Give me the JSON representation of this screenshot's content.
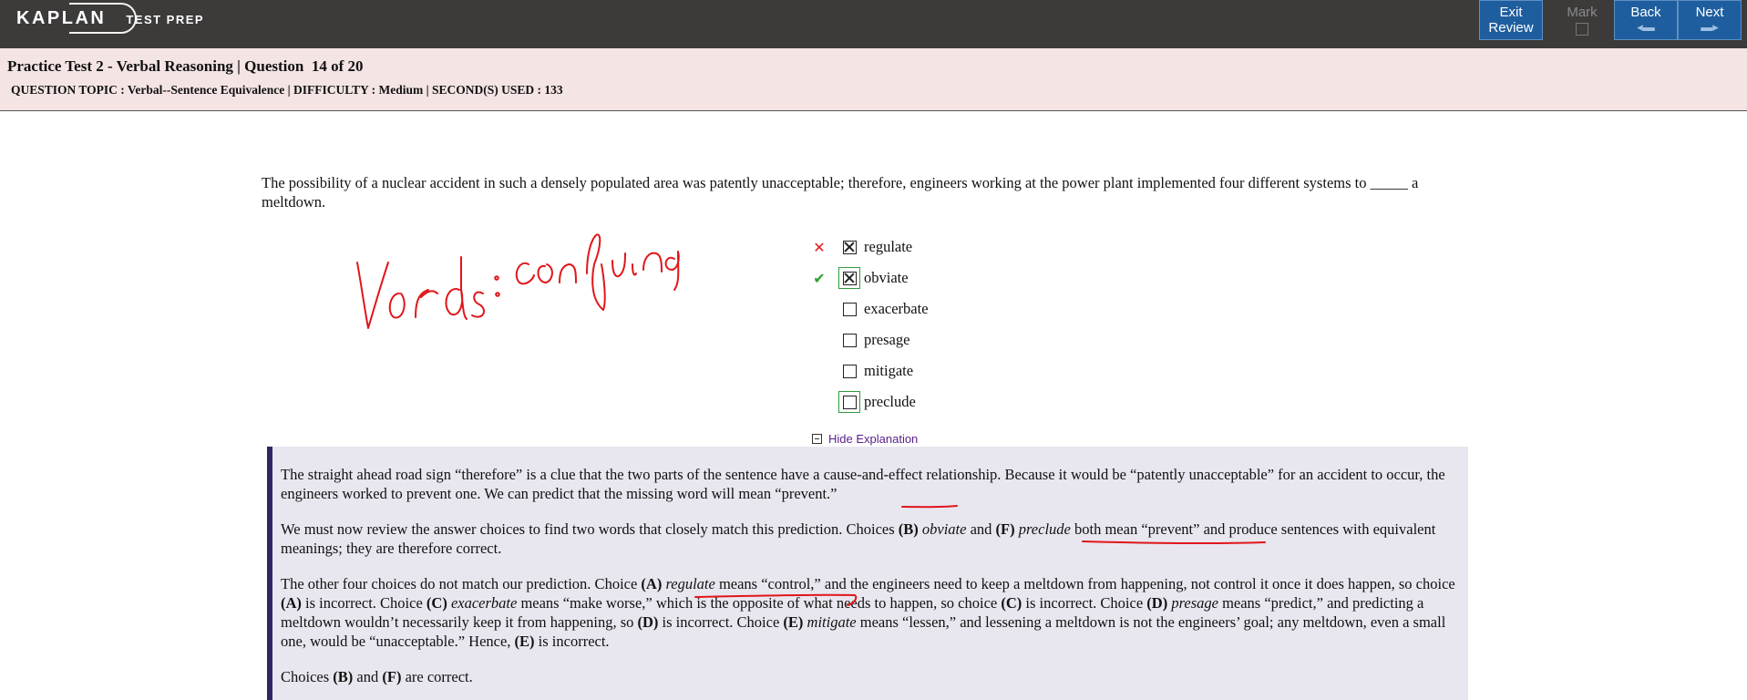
{
  "app": {
    "logo_text": "KAPLAN",
    "logo_sub": "TEST PREP"
  },
  "toolbar": {
    "exit_line1": "Exit",
    "exit_line2": "Review",
    "mark_label": "Mark",
    "back_label": "Back",
    "next_label": "Next"
  },
  "header": {
    "title": "Practice Test 2 - Verbal Reasoning | Question  14 of 20",
    "meta": "QUESTION TOPIC : Verbal--Sentence Equivalence | DIFFICULTY : Medium | SECOND(S) USED : 133"
  },
  "question": {
    "stem": "The possibility of a nuclear accident in such a densely populated area was patently unacceptable; therefore, engineers working at the power plant implemented four different systems to _____ a meltdown.",
    "choices": [
      {
        "label": "regulate",
        "selected": true,
        "result": "wrong",
        "is_correct": false
      },
      {
        "label": "obviate",
        "selected": true,
        "result": "right",
        "is_correct": true
      },
      {
        "label": "exacerbate",
        "selected": false,
        "result": "",
        "is_correct": false
      },
      {
        "label": "presage",
        "selected": false,
        "result": "",
        "is_correct": false
      },
      {
        "label": "mitigate",
        "selected": false,
        "result": "",
        "is_correct": false
      },
      {
        "label": "preclude",
        "selected": false,
        "result": "",
        "is_correct": true
      }
    ]
  },
  "explanation": {
    "toggle_label": "Hide Explanation",
    "p1": "The straight ahead road sign “therefore” is a clue that the two parts of the sentence have a cause-and-effect relationship. Because it would be “patently unacceptable” for an accident to occur, the engineers worked to prevent one. We can predict that the missing word will mean “prevent.”",
    "p2": {
      "a": "We must now review the answer choices to find two words that closely match this prediction. Choices ",
      "b": "(B)",
      "c": " ",
      "d": "obviate",
      "e": " and ",
      "f": "(F)",
      "g": " ",
      "h": "preclude",
      "i": " both mean “prevent” and produce sentences with equivalent meanings; they are therefore correct."
    },
    "p3": {
      "a": "The other four choices do not match our prediction. Choice ",
      "b": "(A)",
      "c": " ",
      "d": "regulate",
      "e": " means “control,” and the engineers need to keep a meltdown from happening, not control it once it does happen, so choice ",
      "f": "(A)",
      "g": " is incorrect. Choice ",
      "h": "(C)",
      "i": " ",
      "j": "exacerbate",
      "k": " means “make worse,” which is the opposite of what needs to happen, so choice ",
      "l": "(C)",
      "m": " is incorrect. Choice ",
      "n": "(D)",
      "o": " ",
      "p": "presage",
      "q": " means “predict,” and predicting a meltdown wouldn’t necessarily keep it from happening, so ",
      "r": "(D)",
      "s": " is incorrect. Choice ",
      "t": "(E)",
      "u": " ",
      "v": "mitigate",
      "w": " means “lessen,” and lessening a meltdown is not the engineers’ goal; any meltdown, even a small one, would be “unacceptable.” Hence, ",
      "x": "(E)",
      "y": " is incorrect."
    },
    "p4": {
      "a": "Choices ",
      "b": "(B)",
      "c": " and ",
      "d": "(F)",
      "e": " are correct."
    }
  },
  "annotations": {
    "handwritten_note": "Words : confusing",
    "ink_color": "#e0161a"
  }
}
